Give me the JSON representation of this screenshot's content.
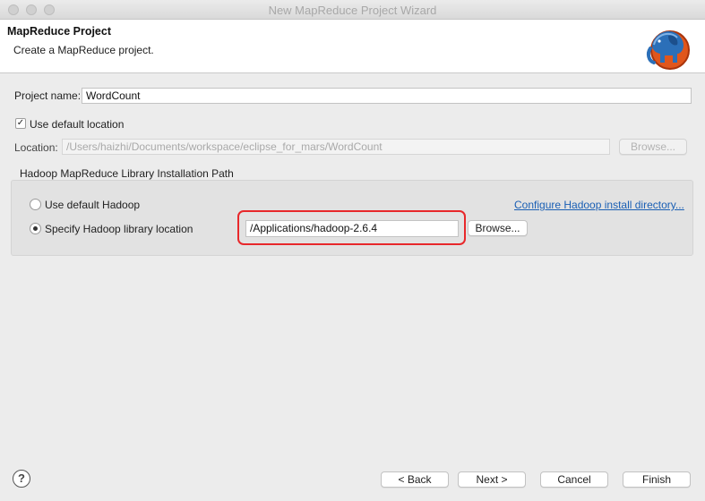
{
  "window": {
    "title": "New MapReduce Project Wizard"
  },
  "header": {
    "title": "MapReduce Project",
    "description": "Create a MapReduce project.",
    "logo_icon": "hadoop-elephant-icon"
  },
  "form": {
    "project_name_label": "Project name:",
    "project_name_value": "WordCount",
    "use_default_location_label": "Use default location",
    "use_default_location_checked": true,
    "location_label": "Location:",
    "location_value": "/Users/haizhi/Documents/workspace/eclipse_for_mars/WordCount",
    "location_browse_label": "Browse..."
  },
  "hadoop_group": {
    "title": "Hadoop MapReduce Library Installation Path",
    "use_default_label": "Use default Hadoop",
    "specify_label": "Specify Hadoop library location",
    "selected": "specify",
    "configure_link": "Configure Hadoop install directory...",
    "library_path": "/Applications/hadoop-2.6.4",
    "browse_label": "Browse..."
  },
  "footer": {
    "help_icon": "help-icon",
    "help_glyph": "?",
    "back_label": "< Back",
    "next_label": "Next >",
    "cancel_label": "Cancel",
    "finish_label": "Finish"
  },
  "colors": {
    "highlight": "#e8282b",
    "link": "#1a5fb4"
  }
}
